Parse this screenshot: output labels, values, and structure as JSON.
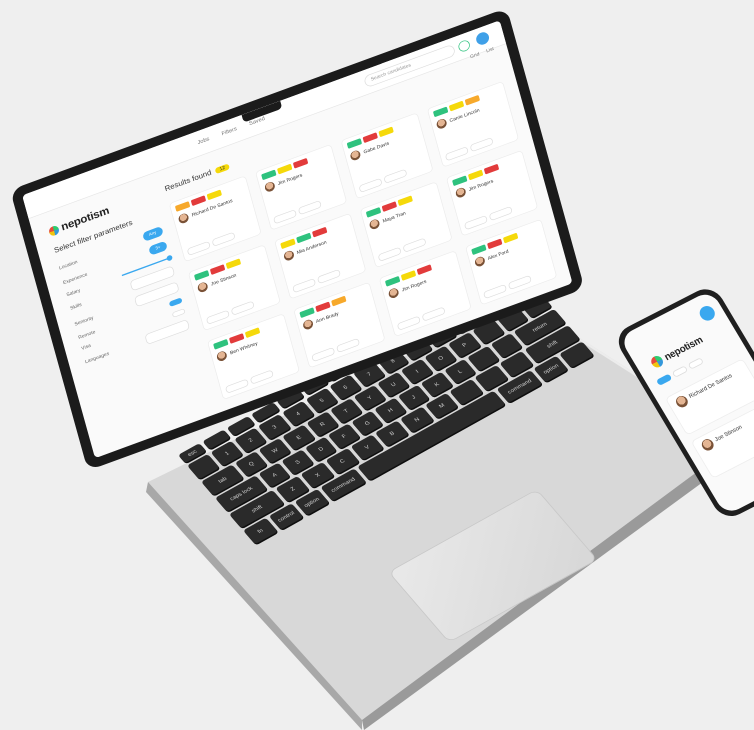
{
  "app": {
    "logo_text": "nepotism",
    "breadcrumbs": [
      "Jobs",
      "Filters",
      "Saved"
    ],
    "search_placeholder": "Search candidates",
    "sidebar_title": "Select filter parameters",
    "results_title": "Results found",
    "results_count": "12",
    "tabs": [
      "Grid",
      "List"
    ]
  },
  "filters": [
    {
      "label": "Location",
      "value": "Any"
    },
    {
      "label": "Experience",
      "value": "3+"
    },
    {
      "label": "Salary",
      "value": ""
    },
    {
      "label": "Skills",
      "value": ""
    },
    {
      "label": "Seniority",
      "value": ""
    },
    {
      "label": "Remote",
      "value": ""
    },
    {
      "label": "Visa",
      "value": ""
    },
    {
      "label": "Languages",
      "value": ""
    }
  ],
  "cards": [
    {
      "name": "Richard De Santos",
      "tags": [
        "o",
        "r",
        "y"
      ]
    },
    {
      "name": "Jim Rogers",
      "tags": [
        "g",
        "y",
        "r"
      ]
    },
    {
      "name": "Gabe Davis",
      "tags": [
        "g",
        "r",
        "y"
      ]
    },
    {
      "name": "Carrie Lincoln",
      "tags": [
        "g",
        "y",
        "o"
      ]
    },
    {
      "name": "Joe Stinson",
      "tags": [
        "g",
        "r",
        "y"
      ]
    },
    {
      "name": "Mia Anderson",
      "tags": [
        "y",
        "g",
        "r"
      ]
    },
    {
      "name": "Maya Tran",
      "tags": [
        "g",
        "r",
        "y"
      ]
    },
    {
      "name": "Jim Rogers",
      "tags": [
        "g",
        "y",
        "r"
      ]
    },
    {
      "name": "Ben Whitney",
      "tags": [
        "g",
        "r",
        "y"
      ]
    },
    {
      "name": "Ann Brady",
      "tags": [
        "g",
        "r",
        "o"
      ]
    },
    {
      "name": "Jim Rogers",
      "tags": [
        "g",
        "y",
        "r"
      ]
    },
    {
      "name": "Alex Ford",
      "tags": [
        "g",
        "r",
        "y"
      ]
    }
  ],
  "phone": {
    "logo_text": "nepotism",
    "cards": [
      "Richard De Santos",
      "Joe Stinson"
    ]
  },
  "colors": {
    "accent": "#3aa8ef",
    "green": "#2ec27e",
    "red": "#e23b3b",
    "yellow": "#f5d90a",
    "orange": "#f7a92b"
  }
}
